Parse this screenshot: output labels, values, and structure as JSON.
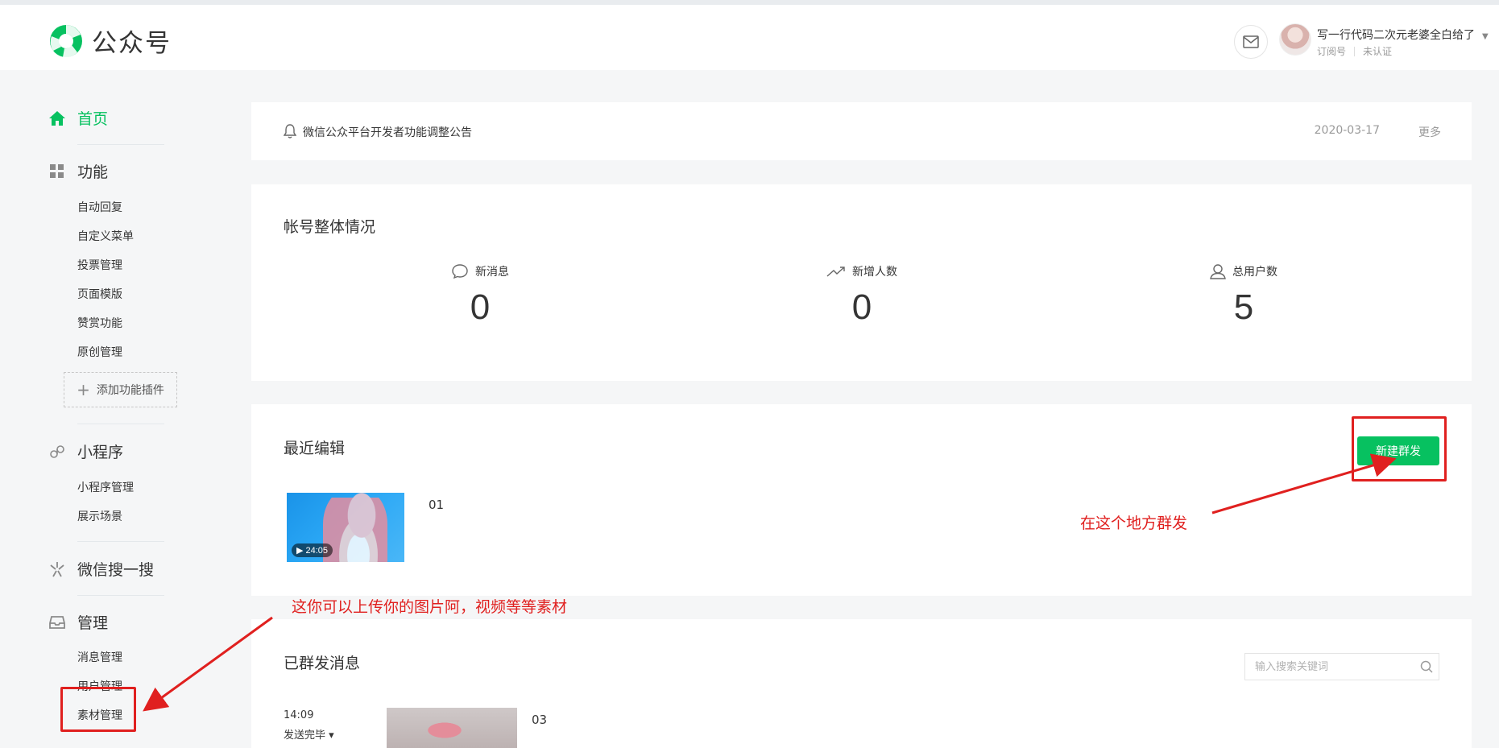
{
  "header": {
    "logo_text": "公众号",
    "user_name": "写一行代码二次元老婆全白给了",
    "account_type": "订阅号",
    "verify_status": "未认证"
  },
  "sidebar": {
    "home": "首页",
    "functions": {
      "title": "功能",
      "items": [
        "自动回复",
        "自定义菜单",
        "投票管理",
        "页面模版",
        "赞赏功能",
        "原创管理"
      ],
      "add_plugin": "添加功能插件"
    },
    "miniprogram": {
      "title": "小程序",
      "items": [
        "小程序管理",
        "展示场景"
      ]
    },
    "search": {
      "title": "微信搜一搜"
    },
    "manage": {
      "title": "管理",
      "items": [
        "消息管理",
        "用户管理",
        "素材管理"
      ]
    }
  },
  "notice": {
    "text": "微信公众平台开发者功能调整公告",
    "date": "2020-03-17",
    "more": "更多"
  },
  "overview": {
    "title": "帐号整体情况",
    "stats": [
      {
        "label": "新消息",
        "value": "0"
      },
      {
        "label": "新增人数",
        "value": "0"
      },
      {
        "label": "总用户数",
        "value": "5"
      }
    ]
  },
  "recent": {
    "title": "最近编辑",
    "new_button": "新建群发",
    "items": [
      {
        "title": "01",
        "duration": "▶ 24:05"
      }
    ]
  },
  "sent": {
    "title": "已群发消息",
    "search_placeholder": "输入搜索关键词",
    "items": [
      {
        "time": "14:09",
        "status": "发送完毕 ▾",
        "title": "03"
      }
    ]
  },
  "annotations": {
    "mass_send": "在这个地方群发",
    "materials": "这你可以上传你的图片阿，视频等等素材"
  },
  "colors": {
    "brand_green": "#07c160",
    "annotation_red": "#e0201f",
    "page_bg": "#f5f6f7"
  }
}
